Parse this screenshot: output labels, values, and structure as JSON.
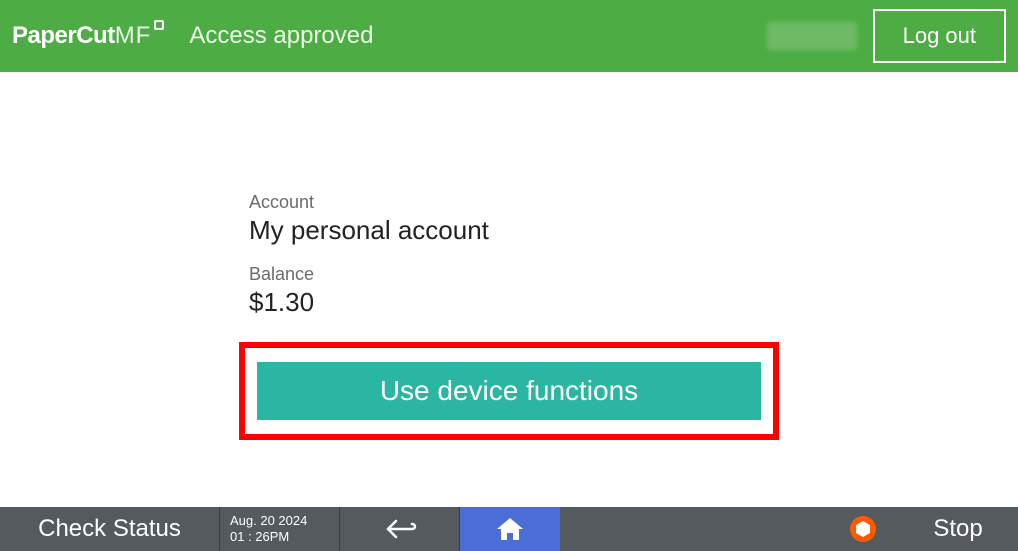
{
  "header": {
    "logo_strong": "PaperCut",
    "logo_light": "MF",
    "status": "Access approved",
    "logout_label": "Log out"
  },
  "account": {
    "label": "Account",
    "value": "My personal account"
  },
  "balance": {
    "label": "Balance",
    "value": "$1.30"
  },
  "primary_action": {
    "label": "Use device functions"
  },
  "footer": {
    "check_status": "Check Status",
    "date": "Aug. 20 2024",
    "time": "01 : 26PM",
    "stop": "Stop"
  },
  "colors": {
    "brand_green": "#4eac44",
    "teal": "#2bb5a3",
    "highlight_red": "#ff0000",
    "footer_gray": "#555a5f",
    "home_blue": "#4a6ed6",
    "stop_orange": "#ff5a00"
  }
}
